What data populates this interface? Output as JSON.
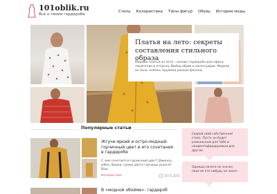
{
  "header": {
    "logo_title": "101oblik.ru",
    "logo_subtitle": "Все о твоем гардеробе",
    "nav": [
      "Стиль",
      "Колористика",
      "Типы фигур",
      "Обувь",
      "История моды"
    ]
  },
  "hero": {
    "title": "Платья на лето: секреты составления стильного образа",
    "text": "Модные платья на лето – основа гардероба для офиса, торжества и отпуска. Выбор обуви и аксессуаров. Модели из льна, хлопка, кружева разные фасоны"
  },
  "popular": {
    "section_title": "Популярные статьи",
    "articles": [
      {
        "title": "Жгуче-яркий и остро-модный: горчичный цвет и его сочетания в гардеробе",
        "desc": "С чем сочетается горчичный цвет? Джинсы, юбки, брюки, сумки цвета горчицы украсят Ваш",
        "tag": "Колористика",
        "date": "14.01.2015"
      },
      {
        "title": "В «модной обойме»: гардероб цвета",
        "desc": "",
        "tag": "",
        "date": ""
      }
    ]
  },
  "sidebar": {
    "quotes": [
      "Скорей свой собственный стиль. Пусть он будет уникальным для тебя и неидентифицируемым для других.",
      "Одежда ничего не значит, пока ее кто-нибудь не носит."
    ]
  },
  "colors": {
    "accent": "#d0566b",
    "quote_bg": "#fbe0e6"
  }
}
